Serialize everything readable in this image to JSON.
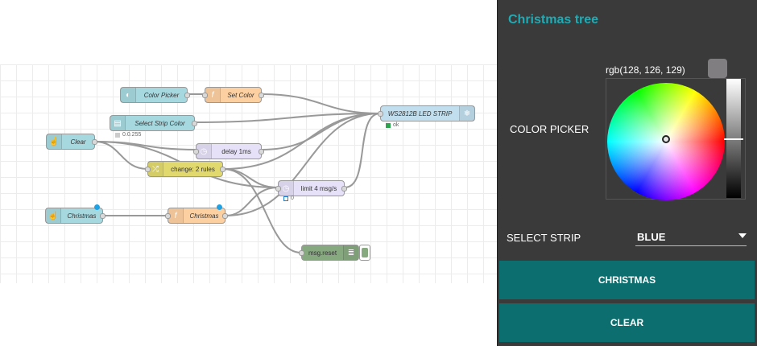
{
  "flow": {
    "nodes": {
      "color_picker": {
        "label": "Color Picker",
        "icon": "palette-icon"
      },
      "set_color": {
        "label": "Set Color",
        "icon": "function-icon"
      },
      "select_strip": {
        "label": "Select Strip Color",
        "icon": "list-icon",
        "status": "0.0.255"
      },
      "ws2812b": {
        "label": "WS2812B LED STRIP",
        "icon": "raspberry-icon",
        "status": "ok"
      },
      "clear": {
        "label": "Clear",
        "icon": "hand-icon"
      },
      "delay": {
        "label": "delay 1ms",
        "icon": "clock-icon"
      },
      "change": {
        "label": "change: 2 rules",
        "icon": "shuffle-icon"
      },
      "limit": {
        "label": "limit 4 msg/s",
        "icon": "clock-icon",
        "status": "0"
      },
      "christmas_btn": {
        "label": "Christmas",
        "icon": "hand-icon"
      },
      "christmas_fn": {
        "label": "Christmas",
        "icon": "function-icon"
      },
      "msg_reset": {
        "label": "msg.reset",
        "icon": "list-icon"
      }
    },
    "colors": {
      "dashboard_node": "#a6d8e0",
      "function_node": "#fdd0a2",
      "change_node": "#e2d96e",
      "delay_node": "#e6e0f8",
      "output_node": "#c0deed",
      "debug_node": "#87a980",
      "wire": "#999999"
    }
  },
  "dashboard": {
    "title": "Christmas tree",
    "color_picker_label": "COLOR PICKER",
    "color_value": "rgb(128, 126, 129)",
    "swatch_color": "#807e81",
    "select_label": "SELECT STRIP",
    "select_value": "BLUE",
    "buttons": {
      "christmas": "CHRISTMAS",
      "clear": "CLEAR"
    },
    "colors": {
      "title": "#1dacb6",
      "panel_bg": "#3a3a3a",
      "button_bg": "#0c6e6e"
    }
  }
}
